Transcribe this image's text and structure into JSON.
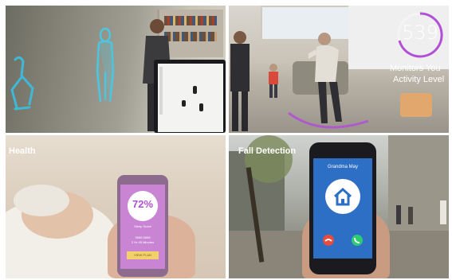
{
  "tiles": {
    "top_right": {
      "counter_value": "539",
      "caption_line1": "Monitors You",
      "caption_line2": "Activity Level"
    },
    "bottom_left": {
      "label": "Health",
      "percent": "72%",
      "percent_sub": "Sleep Score",
      "screen_line1": "9658 5698",
      "screen_line2": "2 Hr 45 Minutes",
      "button_label": "VIEW PLAN"
    },
    "bottom_right": {
      "label": "Fall Detection",
      "caller_name": "Grandma May"
    }
  },
  "colors": {
    "counter_ring": "#b14fd6",
    "health_screen": "#c985d4",
    "call_accept": "#2ecc71",
    "call_decline": "#e74c3c",
    "phone_screen": "#2d6fc4"
  }
}
